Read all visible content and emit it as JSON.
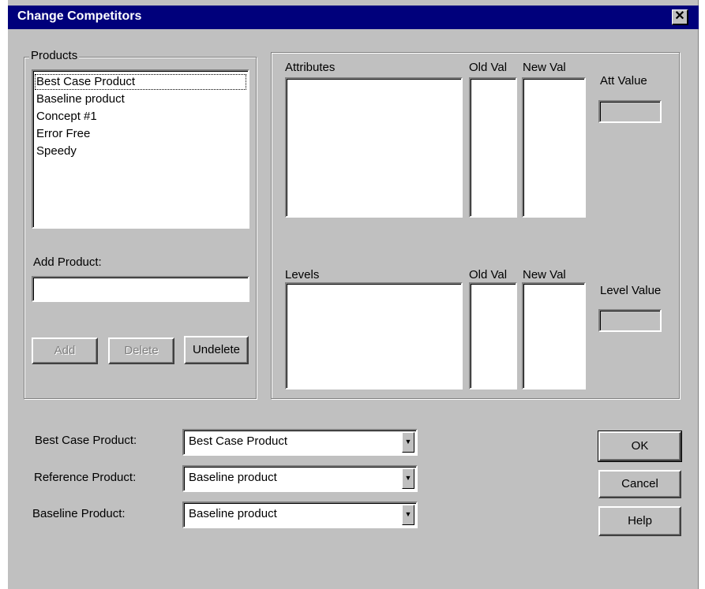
{
  "window": {
    "title": "Change Competitors",
    "close_glyph": "✕"
  },
  "products_group": {
    "label": "Products",
    "items": [
      "Best Case Product",
      "Baseline product",
      "Concept #1",
      "Error Free",
      "Speedy"
    ],
    "selected_index": 0,
    "add_label": "Add Product:",
    "add_value": "",
    "add_button": "Add",
    "delete_button": "Delete",
    "undelete_button": "Undelete"
  },
  "attributes": {
    "header": "Attributes",
    "old_val": "Old Val",
    "new_val": "New Val",
    "value_label": "Att Value",
    "value": ""
  },
  "levels": {
    "header": "Levels",
    "old_val": "Old Val",
    "new_val": "New Val",
    "value_label": "Level Value",
    "value": ""
  },
  "selectors": {
    "best_case": {
      "label": "Best Case Product:",
      "value": "Best Case Product"
    },
    "reference": {
      "label": "Reference Product:",
      "value": "Baseline product"
    },
    "baseline": {
      "label": "Baseline Product:",
      "value": "Baseline product"
    }
  },
  "buttons": {
    "ok": "OK",
    "cancel": "Cancel",
    "help": "Help"
  },
  "icons": {
    "dropdown_arrow": "▼"
  }
}
